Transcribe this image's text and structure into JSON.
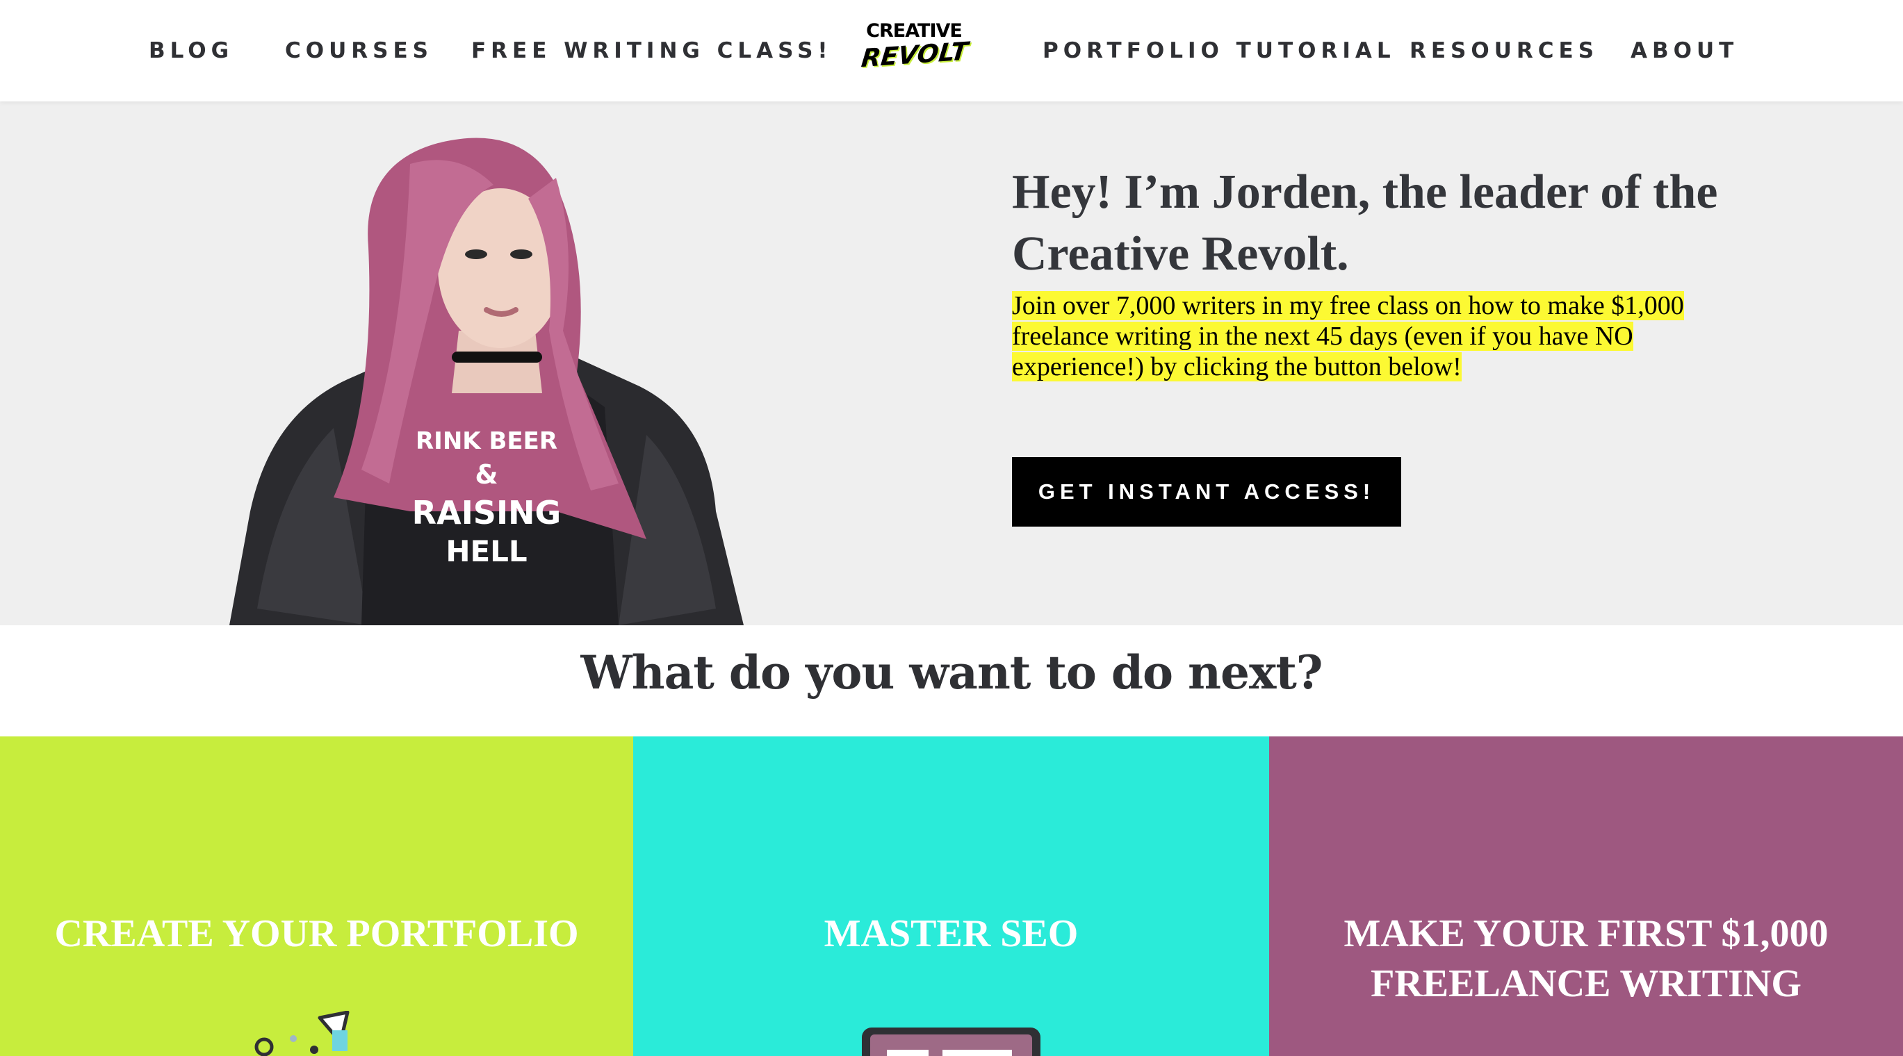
{
  "nav": {
    "items": [
      {
        "label": "BLOG"
      },
      {
        "label": "COURSES"
      },
      {
        "label": "FREE WRITING CLASS!"
      },
      {
        "label": "PORTFOLIO TUTORIAL"
      },
      {
        "label": "RESOURCES"
      },
      {
        "label": "ABOUT"
      }
    ],
    "logo_line1": "CREATIVE",
    "logo_line2": "REVOLT"
  },
  "hero": {
    "title": "Hey! I’m Jorden, the leader of the Creative Revolt.",
    "text": "Join over 7,000 writers in my free class on how to make $1,000 freelance writing in the next 45 days (even if you have NO experience!) by clicking the button below!",
    "cta_label": "GET INSTANT ACCESS!",
    "shirt_line1": "RINK BEER",
    "shirt_line2": "&",
    "shirt_line3": "RAISING",
    "shirt_line4": "HELL"
  },
  "next": {
    "heading": "What do you want to do next?"
  },
  "cards": [
    {
      "title": "CREATE YOUR PORTFOLIO",
      "color": "#c7ed3d",
      "icon": "portfolio-doodle-icon"
    },
    {
      "title": "MASTER SEO",
      "color": "#2aebd9",
      "icon": "computer-monitor-icon"
    },
    {
      "title": "MAKE YOUR FIRST $1,000 FREELANCE WRITING",
      "color": "#9e5880",
      "icon": ""
    }
  ],
  "colors": {
    "lime": "#c7ed3d",
    "turquoise": "#2aebd9",
    "plum": "#9e5880",
    "highlight": "#fcf933",
    "hero_bg": "#efefef",
    "text_dark": "#2f3034"
  }
}
